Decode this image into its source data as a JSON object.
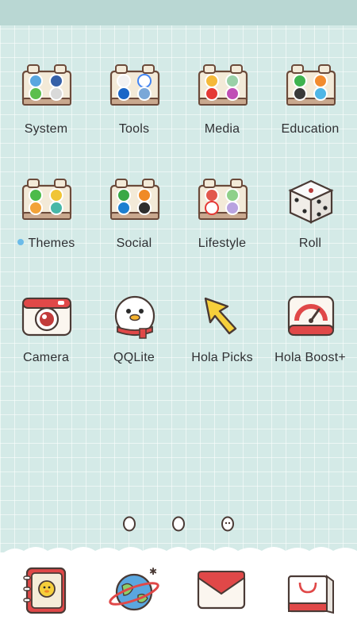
{
  "apps": [
    {
      "label": "System",
      "icon": "folder-icon"
    },
    {
      "label": "Tools",
      "icon": "folder-icon"
    },
    {
      "label": "Media",
      "icon": "folder-icon"
    },
    {
      "label": "Education",
      "icon": "folder-icon"
    },
    {
      "label": "Themes",
      "icon": "folder-icon",
      "badge": "new-dot"
    },
    {
      "label": "Social",
      "icon": "folder-icon"
    },
    {
      "label": "Lifestyle",
      "icon": "folder-icon"
    },
    {
      "label": "Roll",
      "icon": "dice-icon"
    },
    {
      "label": "Camera",
      "icon": "camera-icon"
    },
    {
      "label": "QQLite",
      "icon": "penguin-icon"
    },
    {
      "label": "Hola Picks",
      "icon": "cursor-arrow-icon"
    },
    {
      "label": "Hola Boost+",
      "icon": "speedometer-icon"
    }
  ],
  "pager": {
    "pages": 3,
    "current": 3
  },
  "dock": [
    {
      "icon": "contacts-book-icon"
    },
    {
      "icon": "globe-browser-icon"
    },
    {
      "icon": "mail-envelope-icon"
    },
    {
      "icon": "shopping-bag-icon"
    }
  ],
  "colors": {
    "background": "#d4eae7",
    "status_bar": "#b9d7d3",
    "label": "#2f3033",
    "badge_dot": "#6bbbe9",
    "accent_red": "#e04848"
  }
}
